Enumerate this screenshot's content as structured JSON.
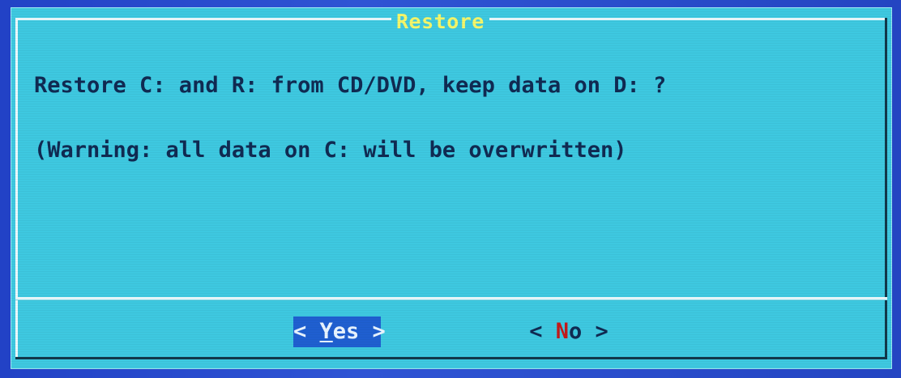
{
  "dialog": {
    "title": "Restore",
    "message_line1": "Restore C: and R: from CD/DVD, keep data on D: ?",
    "message_line2": "(Warning: all data on C: will be overwritten)"
  },
  "buttons": {
    "yes": {
      "open": "< ",
      "hotkey": "Y",
      "rest": "es",
      "close": " >",
      "selected": true
    },
    "no": {
      "open": "< ",
      "hotkey": "N",
      "rest": "o",
      "close": "  >",
      "selected": false
    }
  },
  "colors": {
    "screen_background": "#1f3fb8",
    "dialog_background": "#3ec8e0",
    "title_text": "#f4f66a",
    "body_text": "#102a52",
    "selected_button": "#1f5fd0",
    "hotkey_red": "#c21a1a"
  }
}
